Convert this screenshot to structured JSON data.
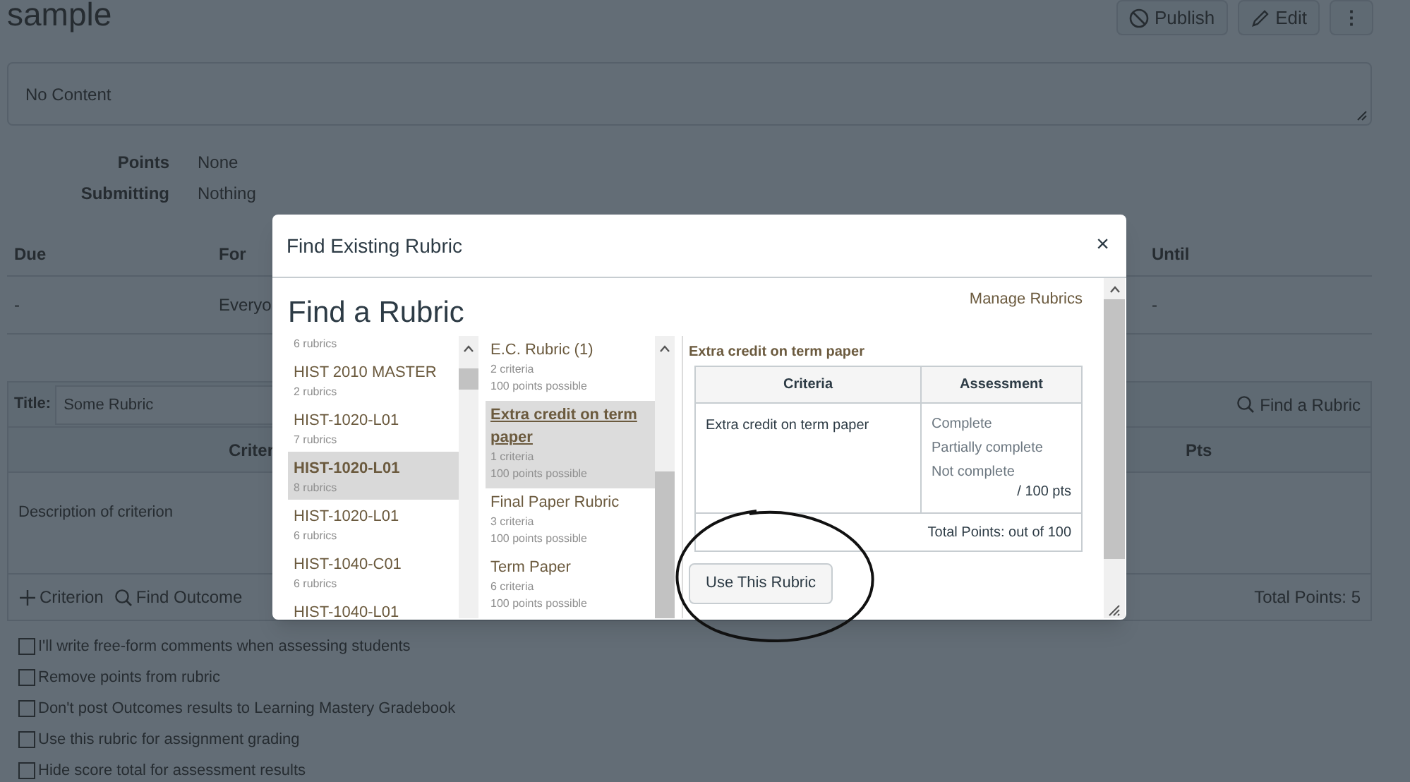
{
  "page": {
    "title": "sample",
    "buttons": [
      {
        "kind": "publish",
        "label": "Publish"
      },
      {
        "kind": "edit",
        "label": "Edit"
      },
      {
        "kind": "more",
        "label": "⋮"
      }
    ],
    "description": "No Content",
    "details": [
      {
        "label": "Points",
        "value": "None"
      },
      {
        "label": "Submitting",
        "value": "Nothing"
      }
    ],
    "dates": {
      "columns": [
        "Due",
        "For",
        "Until"
      ],
      "row": [
        "-",
        "Everyo",
        "-"
      ]
    }
  },
  "rubric_editor": {
    "title_label": "Title:",
    "title_value": "Some Rubric",
    "find_link": "Find a Rubric",
    "columns": [
      "Criter",
      "Pts"
    ],
    "criteria": [
      {
        "description": "Description of criterion"
      }
    ],
    "actions": [
      {
        "kind": "add",
        "label": "Criterion"
      },
      {
        "kind": "search",
        "label": "Find Outcome"
      }
    ],
    "total": "Total Points: 5",
    "options": [
      {
        "label": "I'll write free-form comments when assessing students",
        "checked": false
      },
      {
        "label": "Remove points from rubric",
        "checked": false
      },
      {
        "label": "Don't post Outcomes results to Learning Mastery Gradebook",
        "checked": false
      },
      {
        "label": "Use this rubric for assignment grading",
        "checked": false
      },
      {
        "label": "Hide score total for assessment results",
        "checked": false
      }
    ]
  },
  "modal": {
    "title": "Find Existing Rubric",
    "close": "×",
    "heading": "Find a Rubric",
    "manage_link": "Manage Rubrics",
    "groups": [
      {
        "count": "6 rubrics",
        "selected": false
      },
      {
        "name": "HIST 2010 MASTER",
        "count": "2 rubrics",
        "selected": false
      },
      {
        "name": "HIST-1020-L01",
        "count": "7 rubrics",
        "selected": false
      },
      {
        "name": "HIST-1020-L01",
        "count": "8 rubrics",
        "selected": true
      },
      {
        "name": "HIST-1020-L01",
        "count": "6 rubrics",
        "selected": false
      },
      {
        "name": "HIST-1040-C01",
        "count": "6 rubrics",
        "selected": false
      },
      {
        "name": "HIST-1040-L01",
        "selected": false
      }
    ],
    "rubrics": [
      {
        "name": "E.C. Rubric (1)",
        "criteria": "2 criteria",
        "points": "100 points possible",
        "selected": false
      },
      {
        "name": "Extra credit on term paper",
        "criteria": "1 criteria",
        "points": "100 points possible",
        "selected": true
      },
      {
        "name": "Final Paper Rubric",
        "criteria": "3 criteria",
        "points": "100 points possible",
        "selected": false
      },
      {
        "name": "Term Paper",
        "criteria": "6 criteria",
        "points": "100 points possible",
        "selected": false
      }
    ],
    "preview": {
      "title": "Extra credit on term paper",
      "columns": [
        "Criteria",
        "Assessment"
      ],
      "rows": [
        {
          "criterion": "Extra credit on term paper",
          "ratings": [
            "Complete",
            "Partially complete",
            "Not complete"
          ],
          "points": "/ 100 pts"
        }
      ],
      "total": "Total Points: out of 100",
      "button": "Use This Rubric"
    }
  }
}
